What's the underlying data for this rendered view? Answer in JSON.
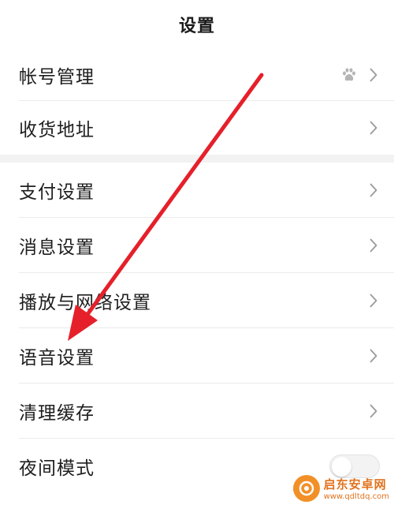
{
  "header": {
    "title": "设置"
  },
  "rows": {
    "account": {
      "label": "帐号管理",
      "icon": "baidu-bear-icon"
    },
    "address": {
      "label": "收货地址"
    },
    "payment": {
      "label": "支付设置"
    },
    "message": {
      "label": "消息设置"
    },
    "playback": {
      "label": "播放与网络设置"
    },
    "voice": {
      "label": "语音设置"
    },
    "cache": {
      "label": "清理缓存"
    },
    "night": {
      "label": "夜间模式",
      "toggle_on": false
    }
  },
  "annotation": {
    "arrow_color": "#e5202a",
    "points_to": "语音设置"
  },
  "watermark": {
    "name": "启东安卓网",
    "url": "www.qdltdq.com",
    "color": "#f28b1d"
  },
  "colors": {
    "text": "#1e1e1e",
    "divider": "#ebebeb",
    "section_gap": "#f2f2f2",
    "chevron": "#9a9a9a"
  }
}
